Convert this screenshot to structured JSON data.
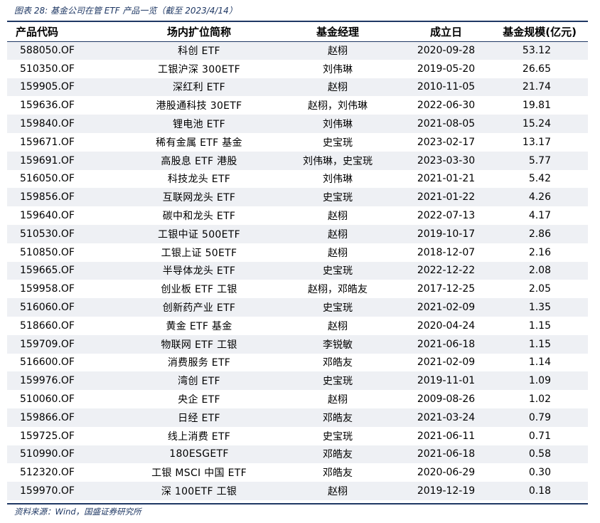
{
  "caption": "图表 28:  基金公司在管 ETF 产品一览（截至 2023/4/14）",
  "source": "资料来源：Wind，国盛证券研究所",
  "table": {
    "headers": [
      "产品代码",
      "场内扩位简称",
      "基金经理",
      "成立日",
      "基金规模(亿元)"
    ],
    "rows": [
      [
        "588050.OF",
        "科创 ETF",
        "赵栩",
        "2020-09-28",
        "53.12"
      ],
      [
        "510350.OF",
        "工银沪深 300ETF",
        "刘伟琳",
        "2019-05-20",
        "26.65"
      ],
      [
        "159905.OF",
        "深红利 ETF",
        "赵栩",
        "2010-11-05",
        "21.74"
      ],
      [
        "159636.OF",
        "港股通科技 30ETF",
        "赵栩，刘伟琳",
        "2022-06-30",
        "19.81"
      ],
      [
        "159840.OF",
        "锂电池 ETF",
        "刘伟琳",
        "2021-08-05",
        "15.24"
      ],
      [
        "159671.OF",
        "稀有金属 ETF 基金",
        "史宝珖",
        "2023-02-17",
        "13.17"
      ],
      [
        "159691.OF",
        "高股息 ETF 港股",
        "刘伟琳，史宝珖",
        "2023-03-30",
        "5.77"
      ],
      [
        "516050.OF",
        "科技龙头 ETF",
        "刘伟琳",
        "2021-01-21",
        "5.42"
      ],
      [
        "159856.OF",
        "互联网龙头 ETF",
        "史宝珖",
        "2021-01-22",
        "4.26"
      ],
      [
        "159640.OF",
        "碳中和龙头 ETF",
        "赵栩",
        "2022-07-13",
        "4.17"
      ],
      [
        "510530.OF",
        "工银中证 500ETF",
        "赵栩",
        "2019-10-17",
        "2.86"
      ],
      [
        "510850.OF",
        "工银上证 50ETF",
        "赵栩",
        "2018-12-07",
        "2.16"
      ],
      [
        "159665.OF",
        "半导体龙头 ETF",
        "史宝珖",
        "2022-12-22",
        "2.08"
      ],
      [
        "159958.OF",
        "创业板 ETF 工银",
        "赵栩，邓皓友",
        "2017-12-25",
        "2.05"
      ],
      [
        "516060.OF",
        "创新药产业 ETF",
        "史宝珖",
        "2021-02-09",
        "1.35"
      ],
      [
        "518660.OF",
        "黄金 ETF 基金",
        "赵栩",
        "2020-04-24",
        "1.15"
      ],
      [
        "159709.OF",
        "物联网 ETF 工银",
        "李锐敏",
        "2021-06-18",
        "1.15"
      ],
      [
        "516600.OF",
        "消费服务 ETF",
        "邓皓友",
        "2021-02-09",
        "1.14"
      ],
      [
        "159976.OF",
        "湾创 ETF",
        "史宝珖",
        "2019-11-01",
        "1.09"
      ],
      [
        "510060.OF",
        "央企 ETF",
        "赵栩",
        "2009-08-26",
        "1.02"
      ],
      [
        "159866.OF",
        "日经 ETF",
        "邓皓友",
        "2021-03-24",
        "0.79"
      ],
      [
        "159725.OF",
        "线上消费 ETF",
        "史宝珖",
        "2021-06-11",
        "0.71"
      ],
      [
        "510990.OF",
        "180ESGETF",
        "邓皓友",
        "2021-06-18",
        "0.58"
      ],
      [
        "512320.OF",
        "工银 MSCI 中国 ETF",
        "邓皓友",
        "2020-06-29",
        "0.30"
      ],
      [
        "159970.OF",
        "深 100ETF 工银",
        "赵栩",
        "2019-12-19",
        "0.18"
      ]
    ]
  }
}
